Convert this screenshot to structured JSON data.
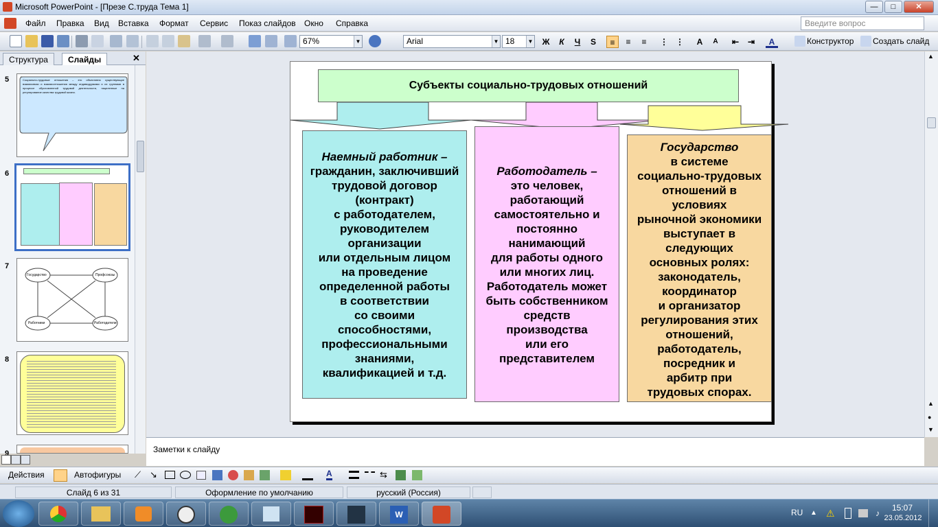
{
  "window": {
    "title": "Microsoft PowerPoint - [Презе С.труда Тема 1]"
  },
  "menu": [
    "Файл",
    "Правка",
    "Вид",
    "Вставка",
    "Формат",
    "Сервис",
    "Показ слайдов",
    "Окно",
    "Справка"
  ],
  "help_placeholder": "Введите вопрос",
  "toolbar": {
    "zoom": "67%",
    "font": "Arial",
    "size": "18",
    "bold": "Ж",
    "italic": "К",
    "underline": "Ч",
    "shadow": "S",
    "designer": "Конструктор",
    "new_slide": "Создать слайд"
  },
  "left_pane": {
    "tabs": [
      "Структура",
      "Слайды"
    ],
    "close": "✕",
    "slide_numbers": [
      "5",
      "6",
      "7",
      "8",
      "9"
    ],
    "thumb5_text": "Социально-трудовые отношения – это объективно существующие взаимосвязи и взаимоотношения между индивидуумами и их группами в процессе обусловленной трудовой деятельности, нацеленные на регулирование качества трудовой жизни.",
    "thumb7_labels": [
      "Государство",
      "Профсоюзы",
      "Работники",
      "Работодатели"
    ]
  },
  "slide": {
    "header": "Субъекты социально-трудовых отношений",
    "col1_title": "Наемный работник –",
    "col1_lines": [
      "гражданин, заключивший",
      "трудовой договор",
      "(контракт)",
      "с работодателем,",
      "руководителем",
      "организации",
      "или отдельным лицом",
      "на проведение",
      "определенной работы",
      "в соответствии",
      "со своими",
      "способностями,",
      "профессиональными",
      "знаниями,",
      "квалификацией и т.д."
    ],
    "col2_title": "Работодатель –",
    "col2_lines": [
      "это человек,",
      "работающий",
      "самостоятельно и",
      "постоянно",
      "нанимающий",
      "для работы одного",
      "или многих лиц.",
      "Работодатель может",
      "быть собственником",
      "средств",
      "производства",
      "или его",
      "представителем"
    ],
    "col3_title": "Государство",
    "col3_lines": [
      "в системе",
      "социально-трудовых",
      "отношений в",
      "условиях",
      "рыночной экономики",
      "выступает в",
      "следующих",
      "основных ролях:",
      "законодатель,",
      "координатор",
      "и организатор",
      "регулирования этих",
      "отношений,",
      "работодатель,",
      "посредник и",
      "арбитр при",
      "трудовых спорах."
    ]
  },
  "notes_placeholder": "Заметки к слайду",
  "drawbar": {
    "actions": "Действия",
    "autoshapes": "Автофигуры"
  },
  "status": {
    "slide": "Слайд 6 из 31",
    "design": "Оформление по умолчанию",
    "lang": "русский (Россия)"
  },
  "tray": {
    "lang": "RU",
    "time": "15:07",
    "date": "23.05.2012"
  },
  "colors": {
    "cyan": "#aeeeee",
    "pink": "#ffccff",
    "orange": "#f8d8a0",
    "header": "#ccffcc",
    "yellow": "#ffff99"
  }
}
